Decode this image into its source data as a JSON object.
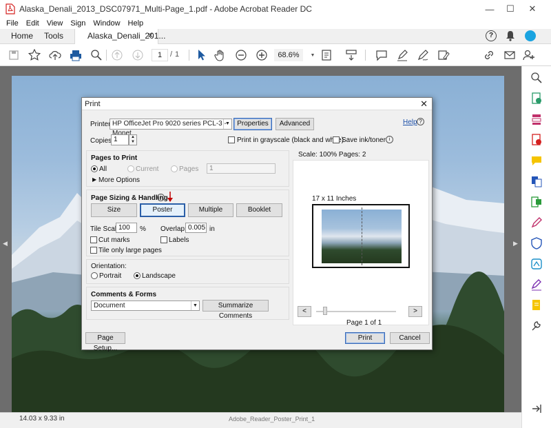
{
  "window": {
    "title": "Alaska_Denali_2013_DSC07971_Multi-Page_1.pdf - Adobe Acrobat Reader DC",
    "minimize": "—",
    "maximize": "☐",
    "close": "✕"
  },
  "menu": [
    "File",
    "Edit",
    "View",
    "Sign",
    "Window",
    "Help"
  ],
  "tabs": {
    "home": "Home",
    "tools": "Tools",
    "document": "Alaska_Denali_201...",
    "close": "✕"
  },
  "toolbar": {
    "page_current": "1",
    "page_sep": "/",
    "page_total": "1",
    "zoom": "68.6%"
  },
  "status": {
    "page_size": "14.03 x 9.33 in",
    "filename": "Adobe_Reader_Poster_Print_1"
  },
  "dialog": {
    "title": "Print",
    "close": "✕",
    "printer_label": "Printer:",
    "printer_value": "HP OfficeJet Pro 9020 series PCL-3 - Monet",
    "properties": "Properties",
    "advanced": "Advanced",
    "help": "Help",
    "copies_label": "Copies:",
    "copies_value": "1",
    "grayscale": "Print in grayscale (black and white)",
    "save_ink": "Save ink/toner",
    "pages_title": "Pages to Print",
    "all": "All",
    "current": "Current",
    "pages": "Pages",
    "pages_value": "1",
    "more_options": "More Options",
    "sizing_title": "Page Sizing & Handling",
    "size": "Size",
    "poster": "Poster",
    "multiple": "Multiple",
    "booklet": "Booklet",
    "tile_scale_label": "Tile Scale:",
    "tile_scale_value": "100",
    "percent": "%",
    "overlap_label": "Overlap:",
    "overlap_value": "0.005",
    "overlap_unit": "in",
    "cut_marks": "Cut marks",
    "labels": "Labels",
    "tile_large": "Tile only large pages",
    "orientation_title": "Orientation:",
    "portrait": "Portrait",
    "landscape": "Landscape",
    "comments_title": "Comments & Forms",
    "comments_value": "Document",
    "summarize": "Summarize Comments",
    "scale_info": "Scale: 100% Pages: 2",
    "paper_size": "17 x 11 Inches",
    "page_of": "Page 1 of 1",
    "prev": "<",
    "next": ">",
    "page_setup": "Page Setup...",
    "print": "Print",
    "cancel": "Cancel"
  },
  "colors": {
    "accent": "#2b5fa8",
    "adobe_red": "#d4201f",
    "arrow_red": "#c00000"
  }
}
